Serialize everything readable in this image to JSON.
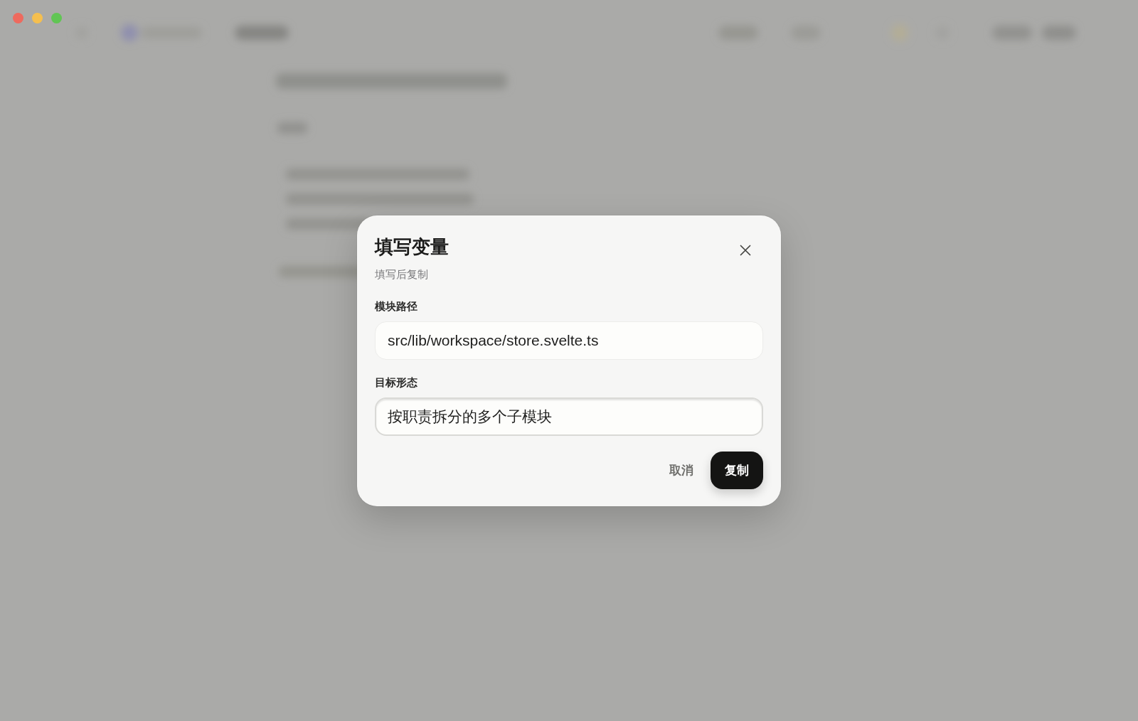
{
  "dialog": {
    "title": "填写变量",
    "subtitle": "填写后复制",
    "fields": [
      {
        "label": "模块路径",
        "value": "src/lib/workspace/store.svelte.ts",
        "focused": false
      },
      {
        "label": "目标形态",
        "value": "按职责拆分的多个子模块",
        "focused": true
      }
    ],
    "buttons": [
      {
        "label": "取消",
        "kind": "text"
      },
      {
        "label": "复制",
        "kind": "primary"
      }
    ]
  }
}
